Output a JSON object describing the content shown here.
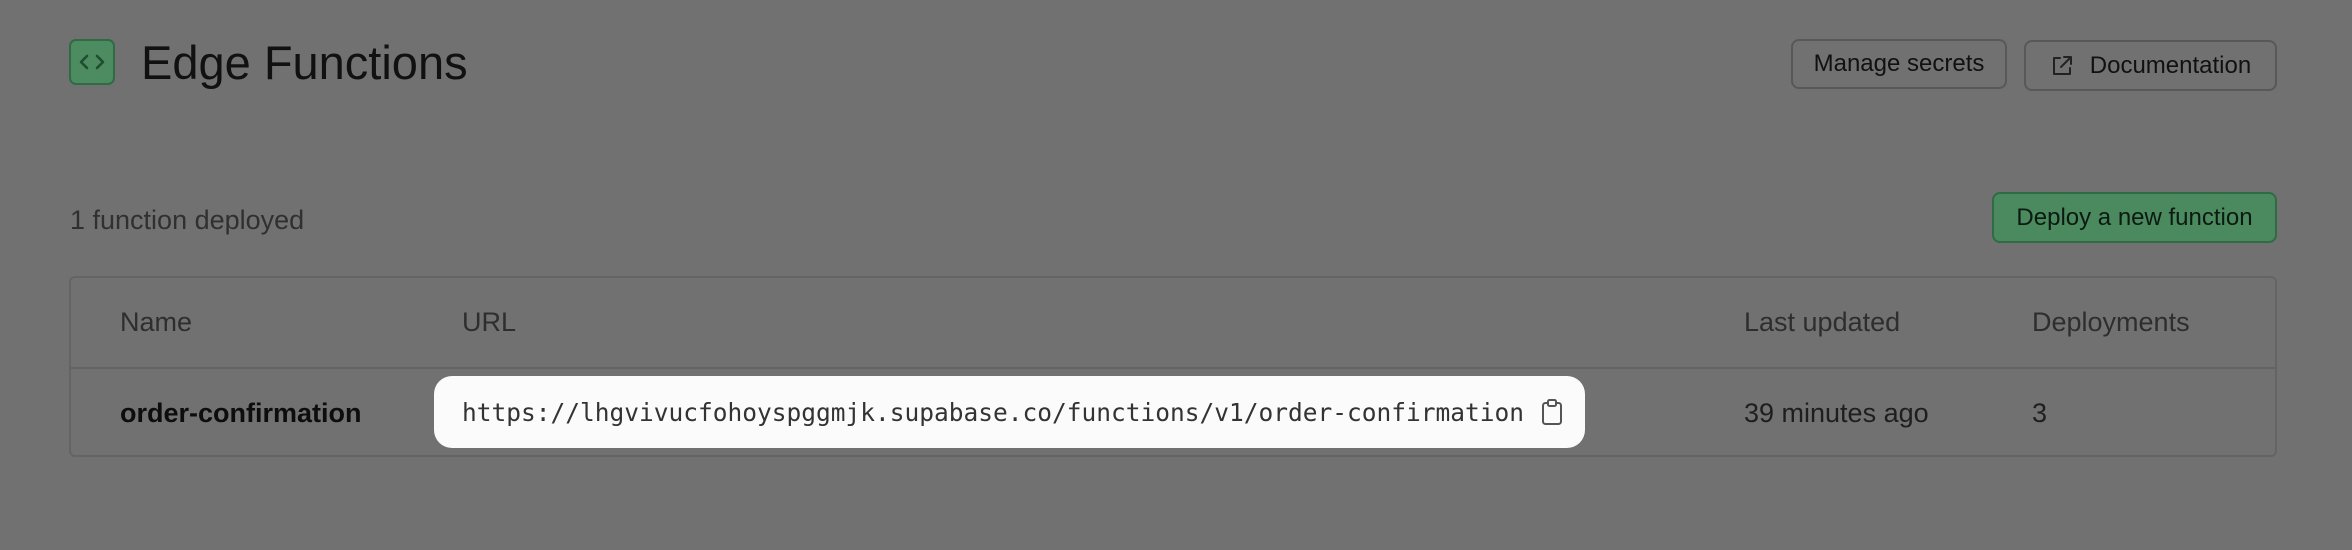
{
  "header": {
    "title": "Edge Functions",
    "icon": "code-brackets-icon",
    "manage_secrets_label": "Manage secrets",
    "documentation_label": "Documentation"
  },
  "summary": {
    "count_text": "1 function deployed",
    "deploy_label": "Deploy a new function"
  },
  "table": {
    "columns": [
      "Name",
      "URL",
      "Last updated",
      "Deployments"
    ],
    "rows": [
      {
        "name": "order-confirmation",
        "url": "https://lhgvivucfohoyspggmjk.supabase.co/functions/v1/order-confirmation",
        "last_updated": "39 minutes ago",
        "deployments": "3"
      }
    ]
  },
  "colors": {
    "overlay": "#717171",
    "accent": "#4c8c60",
    "highlight": "#fbfbfb"
  }
}
